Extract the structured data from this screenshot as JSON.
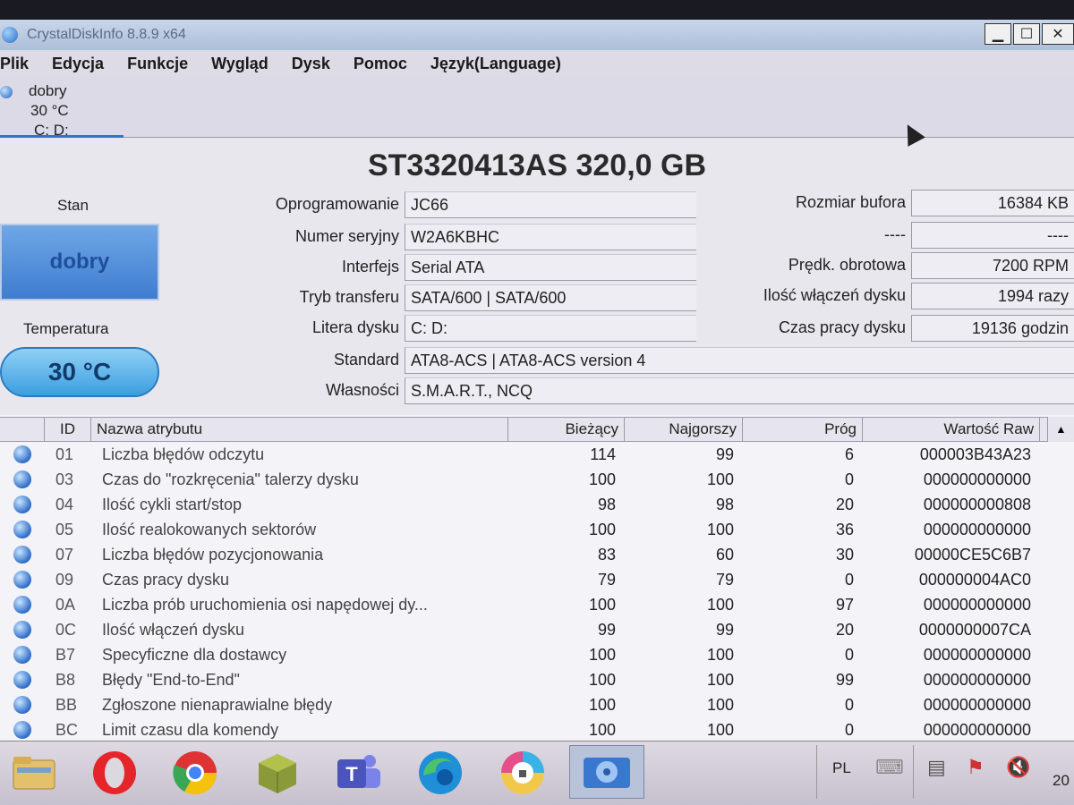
{
  "window": {
    "title": "CrystalDiskInfo 8.8.9 x64"
  },
  "menu": [
    "Plik",
    "Edycja",
    "Funkcje",
    "Wygląd",
    "Dysk",
    "Pomoc",
    "Język(Language)"
  ],
  "disk_tab": {
    "status": "dobry",
    "temperature": "30 °C",
    "letters": "C: D:"
  },
  "model": "ST3320413AS 320,0 GB",
  "status": {
    "label": "Stan",
    "value": "dobry",
    "color": "#3e7cd0"
  },
  "temperature": {
    "label": "Temperatura",
    "value": "30 °C"
  },
  "info": {
    "firmware": {
      "label": "Oprogramowanie",
      "value": "JC66"
    },
    "serial": {
      "label": "Numer seryjny",
      "value": "W2A6KBHC"
    },
    "interface": {
      "label": "Interfejs",
      "value": "Serial ATA"
    },
    "transfer": {
      "label": "Tryb transferu",
      "value": "SATA/600 | SATA/600"
    },
    "letter": {
      "label": "Litera dysku",
      "value": "C: D:"
    },
    "standard": {
      "label": "Standard",
      "value": "ATA8-ACS | ATA8-ACS version 4"
    },
    "features": {
      "label": "Własności",
      "value": "S.M.A.R.T., NCQ"
    }
  },
  "right_info": {
    "buffer": {
      "label": "Rozmiar bufora",
      "value": "16384 KB"
    },
    "blank": {
      "label": "----",
      "value": "----"
    },
    "rpm": {
      "label": "Prędk. obrotowa",
      "value": "7200 RPM"
    },
    "power_count": {
      "label": "Ilość włączeń dysku",
      "value": "1994 razy"
    },
    "power_hours": {
      "label": "Czas pracy dysku",
      "value": "19136 godzin"
    }
  },
  "table": {
    "headers": {
      "id": "ID",
      "name": "Nazwa atrybutu",
      "current": "Bieżący",
      "worst": "Najgorszy",
      "threshold": "Próg",
      "raw": "Wartość Raw"
    },
    "rows": [
      {
        "id": "01",
        "name": "Liczba błędów odczytu",
        "current": "114",
        "worst": "99",
        "threshold": "6",
        "raw": "000003B43A23"
      },
      {
        "id": "03",
        "name": "Czas do \"rozkręcenia\" talerzy dysku",
        "current": "100",
        "worst": "100",
        "threshold": "0",
        "raw": "000000000000"
      },
      {
        "id": "04",
        "name": "Ilość cykli start/stop",
        "current": "98",
        "worst": "98",
        "threshold": "20",
        "raw": "000000000808"
      },
      {
        "id": "05",
        "name": "Ilość realokowanych sektorów",
        "current": "100",
        "worst": "100",
        "threshold": "36",
        "raw": "000000000000"
      },
      {
        "id": "07",
        "name": "Liczba błędów pozycjonowania",
        "current": "83",
        "worst": "60",
        "threshold": "30",
        "raw": "00000CE5C6B7"
      },
      {
        "id": "09",
        "name": "Czas pracy dysku",
        "current": "79",
        "worst": "79",
        "threshold": "0",
        "raw": "000000004AC0"
      },
      {
        "id": "0A",
        "name": "Liczba prób uruchomienia osi napędowej dy...",
        "current": "100",
        "worst": "100",
        "threshold": "97",
        "raw": "000000000000"
      },
      {
        "id": "0C",
        "name": "Ilość włączeń dysku",
        "current": "99",
        "worst": "99",
        "threshold": "20",
        "raw": "0000000007CA"
      },
      {
        "id": "B7",
        "name": "Specyficzne dla dostawcy",
        "current": "100",
        "worst": "100",
        "threshold": "0",
        "raw": "000000000000"
      },
      {
        "id": "B8",
        "name": "Błędy \"End-to-End\"",
        "current": "100",
        "worst": "100",
        "threshold": "99",
        "raw": "000000000000"
      },
      {
        "id": "BB",
        "name": "Zgłoszone nienaprawialne błędy",
        "current": "100",
        "worst": "100",
        "threshold": "0",
        "raw": "000000000000"
      },
      {
        "id": "BC",
        "name": "Limit czasu dla komendy",
        "current": "100",
        "worst": "100",
        "threshold": "0",
        "raw": "000000000000"
      }
    ]
  },
  "taskbar": {
    "language": "PL",
    "clock": "20"
  }
}
